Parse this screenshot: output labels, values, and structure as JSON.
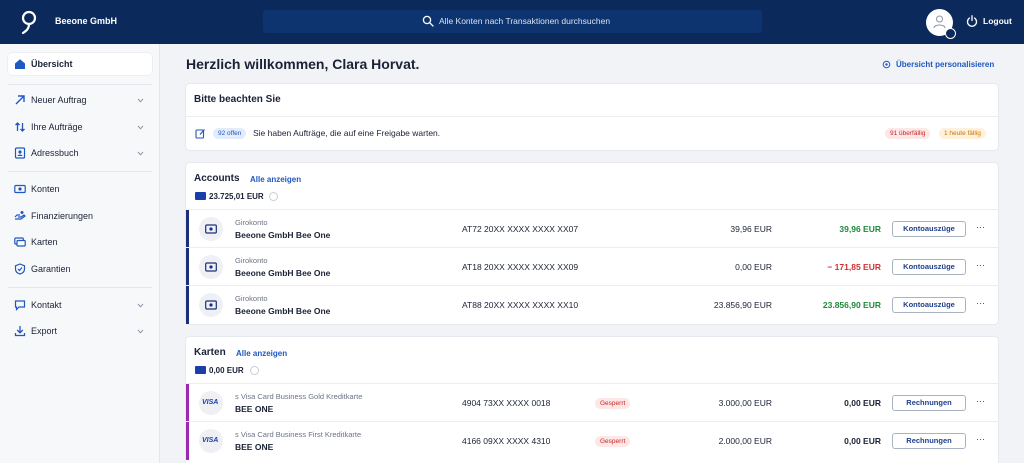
{
  "header": {
    "company": "Beeone GmbH",
    "search_placeholder": "Alle Konten nach Transaktionen durchsuchen",
    "logout": "Logout"
  },
  "sidebar": {
    "items": [
      {
        "label": "Übersicht",
        "icon": "home-icon",
        "active": true
      },
      {
        "label": "Neuer Auftrag",
        "icon": "arrow-up-right-icon"
      },
      {
        "label": "Ihre Aufträge",
        "icon": "transfer-icon"
      },
      {
        "label": "Adressbuch",
        "icon": "address-book-icon"
      },
      {
        "label": "Konten",
        "icon": "account-icon"
      },
      {
        "label": "Finanzierungen",
        "icon": "financing-icon"
      },
      {
        "label": "Karten",
        "icon": "cards-icon"
      },
      {
        "label": "Garantien",
        "icon": "shield-icon"
      },
      {
        "label": "Kontakt",
        "icon": "chat-icon"
      },
      {
        "label": "Export",
        "icon": "download-icon"
      }
    ]
  },
  "main": {
    "greeting": "Herzlich willkommen, Clara Horvat.",
    "personalize": "Übersicht personalisieren",
    "notice": {
      "title": "Bitte beachten Sie",
      "open_badge": "92 offen",
      "text": "Sie haben Aufträge, die auf eine Freigabe warten.",
      "overdue_badge": "91 überfällig",
      "today_badge": "1 heute fällig"
    },
    "accounts": {
      "title": "Accounts",
      "link": "Alle anzeigen",
      "sum": "23.725,01 EUR",
      "rows": [
        {
          "type": "Girokonto",
          "name": "Beeone GmbH Bee One",
          "iban": "AT72 20XX XXXX XXXX XX07",
          "balance": "39,96 EUR",
          "available": "39,96 EUR",
          "available_color": "#1e8a3a",
          "button": "Kontoauszüge",
          "more": "···"
        },
        {
          "type": "Girokonto",
          "name": "Beeone GmbH Bee One",
          "iban": "AT18 20XX XXXX XXXX XX09",
          "balance": "0,00 EUR",
          "available": "− 171,85 EUR",
          "available_color": "#d32f2f",
          "button": "Kontoauszüge",
          "more": "···"
        },
        {
          "type": "Girokonto",
          "name": "Beeone GmbH Bee One",
          "iban": "AT88 20XX XXXX XXXX XX10",
          "balance": "23.856,90 EUR",
          "available": "23.856,90 EUR",
          "available_color": "#1e8a3a",
          "button": "Kontoauszüge",
          "more": "···"
        }
      ]
    },
    "cards": {
      "title": "Karten",
      "link": "Alle anzeigen",
      "sum": "0,00 EUR",
      "rows": [
        {
          "type": "s Visa Card Business Gold Kreditkarte",
          "name": "BEE ONE",
          "number": "4904 73XX XXXX 0018",
          "status": "Gesperrt",
          "limit": "3.000,00 EUR",
          "balance": "0,00 EUR",
          "button": "Rechnungen",
          "more": "···",
          "brand": "VISA"
        },
        {
          "type": "s Visa Card Business First Kreditkarte",
          "name": "BEE ONE",
          "number": "4166 09XX XXXX 4310",
          "status": "Gesperrt",
          "limit": "2.000,00 EUR",
          "balance": "0,00 EUR",
          "button": "Rechnungen",
          "more": "···",
          "brand": "VISA"
        }
      ]
    }
  },
  "colors": {
    "topbar": "#0b2a5b",
    "accent": "#1f57c3",
    "account_bar": "#1b2f7a",
    "card_bar": "#9c27b0"
  }
}
